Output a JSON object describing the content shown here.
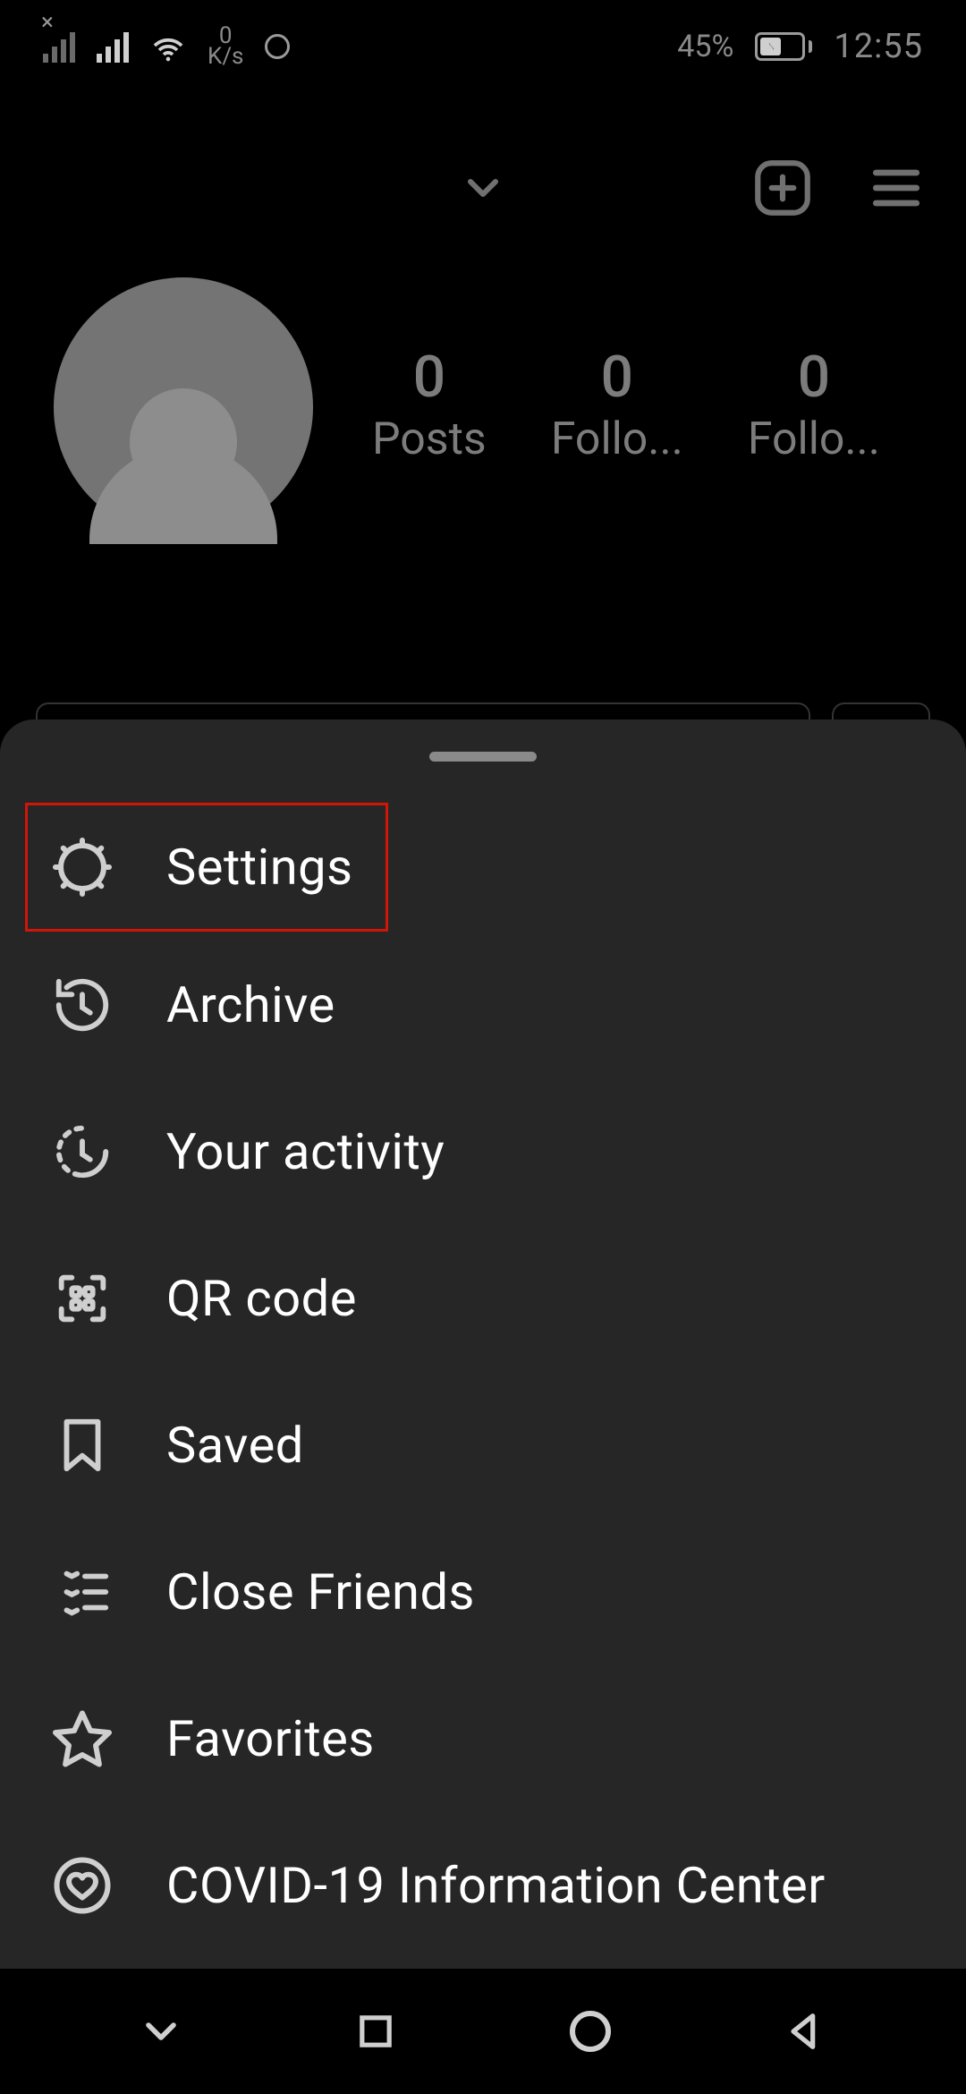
{
  "status_bar": {
    "net_speed_value": "0",
    "net_speed_unit": "K/s",
    "battery_percent": "45%",
    "clock": "12:55"
  },
  "profile": {
    "stats": [
      {
        "value": "0",
        "label": "Posts"
      },
      {
        "value": "0",
        "label": "Follo..."
      },
      {
        "value": "0",
        "label": "Follo..."
      }
    ]
  },
  "menu": {
    "items": [
      {
        "label": "Settings"
      },
      {
        "label": "Archive"
      },
      {
        "label": "Your activity"
      },
      {
        "label": "QR code"
      },
      {
        "label": "Saved"
      },
      {
        "label": "Close Friends"
      },
      {
        "label": "Favorites"
      },
      {
        "label": "COVID-19 Information Center"
      }
    ]
  },
  "annotations": {
    "settings_highlight_color": "#d11507"
  }
}
